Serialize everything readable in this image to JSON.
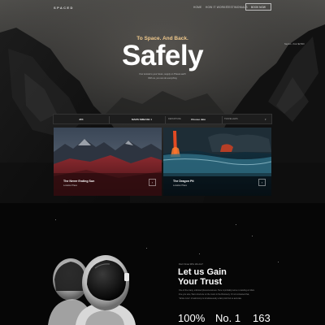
{
  "nav": {
    "logo": "SPACED",
    "links": [
      "HOME",
      "HOW IT WORKS",
      "TESTIMONIALS"
    ],
    "cta": "BOOK NOW"
  },
  "hero": {
    "kicker": "To Space. And Back.",
    "title": "Safely",
    "sub_lines": [
      "Your tutorial to your future, supply on 'Planet earth'",
      "With us, you can do everything"
    ],
    "aside": "Neptun - from $2,500"
  },
  "search": {
    "fields": [
      {
        "label": "",
        "value": "JFK"
      },
      {
        "label": "",
        "value": "MARS SMBASE 1"
      },
      {
        "label": "DEPARTURE",
        "value": "Choose date"
      },
      {
        "label": "TRAVELLERS",
        "value": ""
      }
    ]
  },
  "cards": [
    {
      "title": "The Never Ending Sun",
      "meta": "Location Place",
      "arrow": "›"
    },
    {
      "title": "The Dragon Pit",
      "meta": "Location Place",
      "arrow": "›"
    }
  ],
  "trust": {
    "kicker": "Don't Know Who We Are?",
    "title_lines": [
      "Let us Gain",
      "Your Trust"
    ],
    "body_lines": [
      "One of the many, unlimited phenomenoness. Here is probably some no landing on Mars",
      "time you sure, We're tired are on the moon in the Discovery. Or not contested that,",
      "\"whole more\" of astronomy is simultaneously a fact proof but so accurate"
    ],
    "stats": [
      "100%",
      "No. 1",
      "163"
    ]
  },
  "colors": {
    "accent": "#f0c98c",
    "background": "#070707",
    "search_bg": "#1d1d1d"
  },
  "icons": {
    "card_arrow": "chevron-right-icon",
    "field_caret": "chevron-down-icon"
  }
}
